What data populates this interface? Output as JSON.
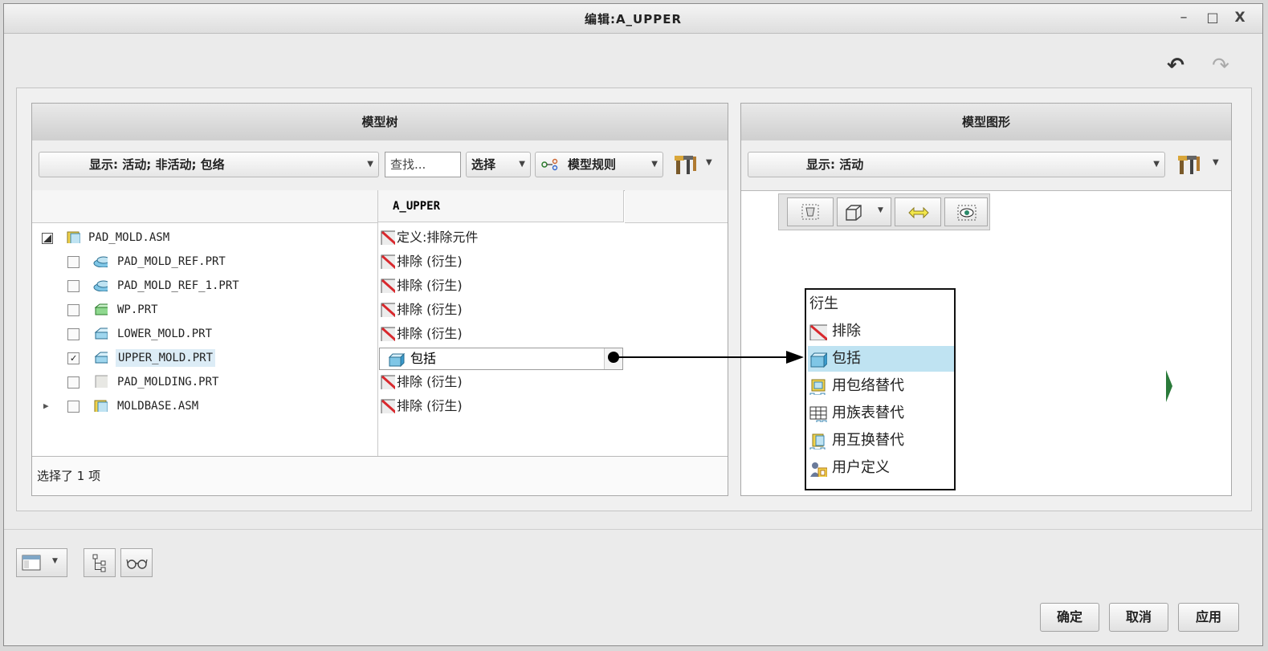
{
  "window": {
    "title": "编辑:A_UPPER",
    "minimize": "–",
    "maximize": "□",
    "close": "X"
  },
  "history": {
    "undo": "↶",
    "redo": "↷"
  },
  "left_panel": {
    "title": "模型树",
    "display_combo": "显示: 活动; 非活动; 包络",
    "search_placeholder": "查找...",
    "select_label": "选择",
    "model_rules_label": "模型规则",
    "column_header": "A_UPPER",
    "tree": [
      {
        "name": "PAD_MOLD.ASM",
        "rule": "定义:排除元件"
      },
      {
        "name": "PAD_MOLD_REF.PRT",
        "rule": "排除 (衍生)"
      },
      {
        "name": "PAD_MOLD_REF_1.PRT",
        "rule": "排除 (衍生)"
      },
      {
        "name": "WP.PRT",
        "rule": "排除 (衍生)"
      },
      {
        "name": "LOWER_MOLD.PRT",
        "rule": "排除 (衍生)"
      },
      {
        "name": "UPPER_MOLD.PRT",
        "rule": "包括",
        "checked": true
      },
      {
        "name": "PAD_MOLDING.PRT",
        "rule": "排除 (衍生)"
      },
      {
        "name": "MOLDBASE.ASM",
        "rule": "排除 (衍生)"
      }
    ],
    "status": "选择了 1 项"
  },
  "right_panel": {
    "title": "模型图形",
    "display_combo": "显示: 活动"
  },
  "popup_menu": {
    "items": [
      {
        "label": "衍生",
        "icon": ""
      },
      {
        "label": "排除",
        "icon": "exclude-icon"
      },
      {
        "label": "包括",
        "icon": "include-icon",
        "selected": true
      },
      {
        "label": "用包络替代",
        "icon": "envelope-substitute-icon"
      },
      {
        "label": "用族表替代",
        "icon": "family-table-icon"
      },
      {
        "label": "用互换替代",
        "icon": "interchange-icon"
      },
      {
        "label": "用户定义",
        "icon": "user-defined-icon"
      }
    ]
  },
  "buttons": {
    "ok": "确定",
    "cancel": "取消",
    "apply": "应用"
  },
  "colors": {
    "selected_bg": "#bfe3f2",
    "exclude_red": "#d9282d"
  }
}
